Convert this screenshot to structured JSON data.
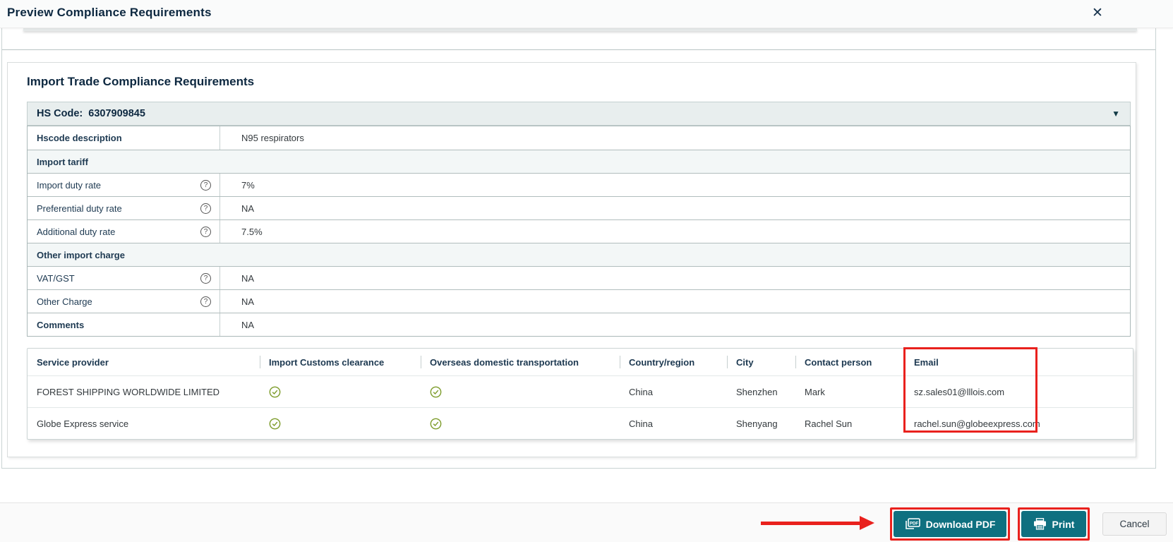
{
  "dialog": {
    "title": "Preview Compliance Requirements",
    "close_icon": "✕"
  },
  "panel": {
    "title": "Import Trade Compliance Requirements"
  },
  "hs": {
    "label": "HS Code:",
    "code": "6307909845",
    "collapse_icon": "▼"
  },
  "details": {
    "rows": [
      {
        "label": "Hscode description",
        "value": "N95 respirators"
      },
      {
        "label": "Import tariff"
      },
      {
        "label": "Import duty rate",
        "value": "7%",
        "help": "?"
      },
      {
        "label": "Preferential duty rate",
        "value": "NA",
        "help": "?"
      },
      {
        "label": "Additional duty rate",
        "value": "7.5%",
        "help": "?"
      },
      {
        "label": "Other import charge"
      },
      {
        "label": "VAT/GST",
        "value": "NA",
        "help": "?"
      },
      {
        "label": "Other Charge",
        "value": "NA",
        "help": "?"
      },
      {
        "label": "Comments",
        "value": "NA"
      }
    ]
  },
  "providers": {
    "columns": [
      "Service provider",
      "Import Customs clearance",
      "Overseas domestic transportation",
      "Country/region",
      "City",
      "Contact person",
      "Email"
    ],
    "rows": [
      {
        "name": "FOREST SHIPPING WORLDWIDE LIMITED",
        "import_customs_clearance": true,
        "overseas_domestic_transportation": true,
        "country": "China",
        "city": "Shenzhen",
        "contact": "Mark",
        "email": "sz.sales01@lllois.com"
      },
      {
        "name": "Globe Express service",
        "import_customs_clearance": true,
        "overseas_domestic_transportation": true,
        "country": "China",
        "city": "Shenyang",
        "contact": "Rachel Sun",
        "email": "rachel.sun@globeexpress.com"
      }
    ]
  },
  "footer": {
    "download_label": "Download PDF",
    "print_label": "Print",
    "cancel_label": "Cancel"
  },
  "colors": {
    "accent_teal": "#0f7080",
    "annotation_red": "#e9211d",
    "check_green": "#7d9c2b",
    "title_navy": "#0d2840"
  }
}
